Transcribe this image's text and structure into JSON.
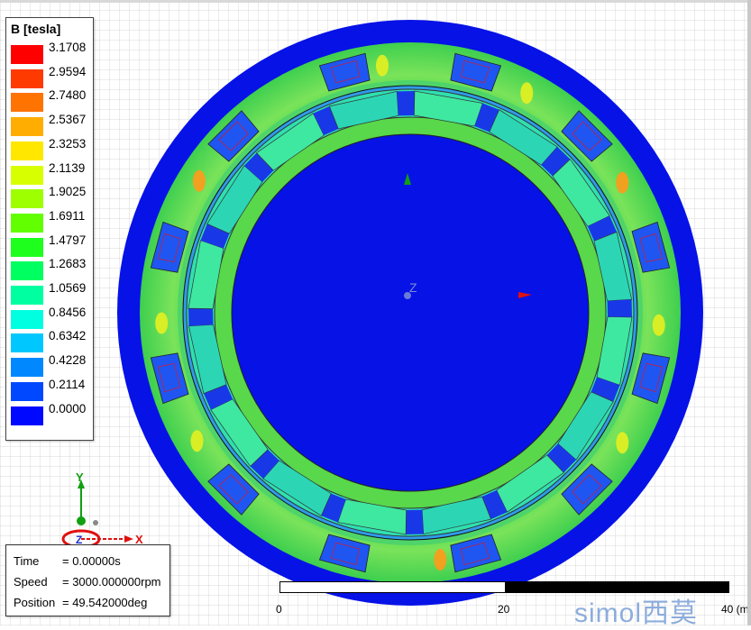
{
  "legend": {
    "title": "B [tesla]",
    "levels": [
      {
        "value": "3.1708",
        "color": "#ff0000"
      },
      {
        "value": "2.9594",
        "color": "#ff3a00"
      },
      {
        "value": "2.7480",
        "color": "#ff7300"
      },
      {
        "value": "2.5367",
        "color": "#ffad00"
      },
      {
        "value": "2.3253",
        "color": "#ffe700"
      },
      {
        "value": "2.1139",
        "color": "#d8ff00"
      },
      {
        "value": "1.9025",
        "color": "#9eff00"
      },
      {
        "value": "1.6911",
        "color": "#62ff00"
      },
      {
        "value": "1.4797",
        "color": "#1eff1e"
      },
      {
        "value": "1.2683",
        "color": "#00ff60"
      },
      {
        "value": "1.0569",
        "color": "#00ffa0"
      },
      {
        "value": "0.8456",
        "color": "#00ffe0"
      },
      {
        "value": "0.6342",
        "color": "#00c8ff"
      },
      {
        "value": "0.4228",
        "color": "#0088ff"
      },
      {
        "value": "0.2114",
        "color": "#0048ff"
      },
      {
        "value": "0.0000",
        "color": "#0008ff"
      }
    ]
  },
  "info": {
    "time_key": "Time",
    "time_value": "= 0.00000s",
    "speed_key": "Speed",
    "speed_value": "= 3000.000000rpm",
    "position_key": "Position",
    "position_value": "= 49.542000deg"
  },
  "triad": {
    "y_label": "Y",
    "z_label": "Z",
    "x_label": "X"
  },
  "scale": {
    "tick_0": "0",
    "tick_20": "20",
    "tick_40": "40 (m"
  },
  "model": {
    "center_label": "Z"
  },
  "watermark": "simol西莫",
  "colors": {
    "background_blue": "#0010e8",
    "stator_green": "#3ddc3d",
    "slot_blue": "#1a4cf0",
    "magnet_green": "#3ee6a0",
    "hot_orange": "#ff9a1a"
  }
}
